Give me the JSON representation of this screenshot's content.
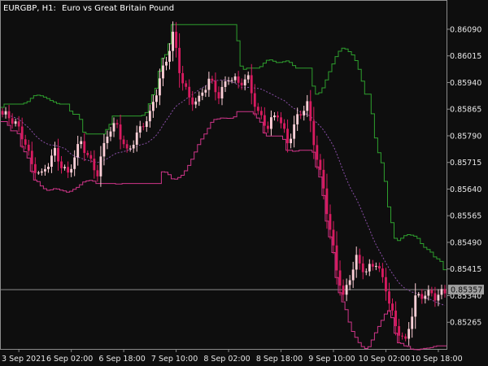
{
  "window": {
    "symbol_label": "EURGBP, H1:",
    "description": "Euro vs Great Britain Pound"
  },
  "colors": {
    "background": "#0e0e0e",
    "frame": "#8c8c8c",
    "text": "#e6e6e6",
    "bull_candle": "#ffd0d8",
    "bear_candle": "#d81b60",
    "upper_band": "#2ea02e",
    "lower_band": "#d0358a",
    "middle_line": "#8a4fa8",
    "price_line": "#8c8c8c",
    "price_tag_bg": "#9e9e9e"
  },
  "current_price": {
    "value": 0.85357,
    "label": "0.85357"
  },
  "chart_data": {
    "type": "candlestick",
    "y_axis": {
      "range": [
        0.8519,
        0.8617
      ],
      "ticks": [
        {
          "value": 0.8609,
          "label": "0.86090"
        },
        {
          "value": 0.86015,
          "label": "0.86015"
        },
        {
          "value": 0.8594,
          "label": "0.85940"
        },
        {
          "value": 0.85865,
          "label": "0.85865"
        },
        {
          "value": 0.8579,
          "label": "0.85790"
        },
        {
          "value": 0.85715,
          "label": "0.85715"
        },
        {
          "value": 0.8564,
          "label": "0.85640"
        },
        {
          "value": 0.85565,
          "label": "0.85565"
        },
        {
          "value": 0.8549,
          "label": "0.85490"
        },
        {
          "value": 0.85415,
          "label": "0.85415"
        },
        {
          "value": 0.8534,
          "label": "0.85340"
        },
        {
          "value": 0.85265,
          "label": "0.85265"
        }
      ]
    },
    "x_axis": {
      "bar_count": 136,
      "ticks": [
        {
          "bar": 5,
          "label": "3 Sep 2021"
        },
        {
          "bar": 21,
          "label": "6 Sep 02:00"
        },
        {
          "bar": 37,
          "label": "6 Sep 18:00"
        },
        {
          "bar": 53,
          "label": "7 Sep 10:00"
        },
        {
          "bar": 69,
          "label": "8 Sep 02:00"
        },
        {
          "bar": 85,
          "label": "8 Sep 18:00"
        },
        {
          "bar": 101,
          "label": "9 Sep 10:00"
        },
        {
          "bar": 117,
          "label": "10 Sep 02:00"
        },
        {
          "bar": 133,
          "label": "10 Sep 18:00"
        }
      ]
    },
    "close_path": [
      [
        0,
        0.8585
      ],
      [
        4,
        0.8582
      ],
      [
        7,
        0.8578
      ],
      [
        9,
        0.8571
      ],
      [
        12,
        0.8567
      ],
      [
        16,
        0.8575
      ],
      [
        20,
        0.8568
      ],
      [
        24,
        0.8577
      ],
      [
        29,
        0.8569
      ],
      [
        32,
        0.8579
      ],
      [
        35,
        0.8582
      ],
      [
        38,
        0.8575
      ],
      [
        42,
        0.858
      ],
      [
        45,
        0.8585
      ],
      [
        48,
        0.8596
      ],
      [
        50,
        0.86
      ],
      [
        52,
        0.8607
      ],
      [
        54,
        0.8597
      ],
      [
        57,
        0.859
      ],
      [
        60,
        0.8589
      ],
      [
        63,
        0.8594
      ],
      [
        66,
        0.8591
      ],
      [
        69,
        0.8596
      ],
      [
        72,
        0.8593
      ],
      [
        75,
        0.8595
      ],
      [
        78,
        0.8586
      ],
      [
        81,
        0.8581
      ],
      [
        84,
        0.8585
      ],
      [
        87,
        0.8578
      ],
      [
        90,
        0.8584
      ],
      [
        93,
        0.8587
      ],
      [
        96,
        0.8573
      ],
      [
        98,
        0.8565
      ],
      [
        100,
        0.8552
      ],
      [
        102,
        0.8541
      ],
      [
        104,
        0.8533
      ],
      [
        106,
        0.854
      ],
      [
        108,
        0.8545
      ],
      [
        111,
        0.854
      ],
      [
        114,
        0.8543
      ],
      [
        117,
        0.8537
      ],
      [
        120,
        0.8525
      ],
      [
        123,
        0.852
      ],
      [
        126,
        0.8534
      ],
      [
        129,
        0.8535
      ],
      [
        132,
        0.8533
      ],
      [
        135,
        0.8535
      ]
    ],
    "band_period": 20,
    "band_deviation": 2.0,
    "series": [
      {
        "role": "candles"
      },
      {
        "role": "upper_band"
      },
      {
        "role": "middle_line"
      },
      {
        "role": "lower_band"
      }
    ]
  }
}
